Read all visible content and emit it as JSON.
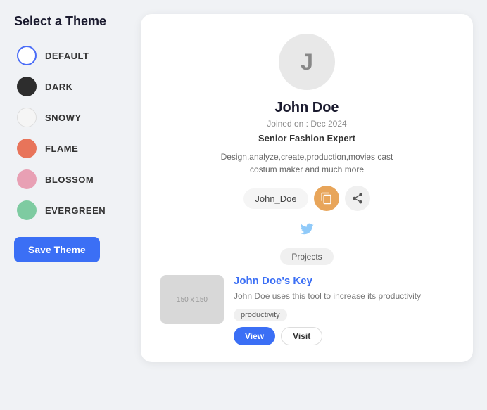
{
  "page": {
    "title": "Select a Theme"
  },
  "themes": [
    {
      "id": "default",
      "label": "DEFAULT",
      "circle_class": "circle-default"
    },
    {
      "id": "dark",
      "label": "DARK",
      "circle_class": "circle-dark"
    },
    {
      "id": "snowy",
      "label": "SNOWY",
      "circle_class": "circle-snowy"
    },
    {
      "id": "flame",
      "label": "FLAME",
      "circle_class": "circle-flame"
    },
    {
      "id": "blossom",
      "label": "BLOSSOM",
      "circle_class": "circle-blossom"
    },
    {
      "id": "evergreen",
      "label": "EVERGREEN",
      "circle_class": "circle-evergreen"
    }
  ],
  "save_button": "Save Theme",
  "profile": {
    "avatar_letter": "J",
    "name": "John Doe",
    "joined": "Joined on : Dec 2024",
    "title": "Senior Fashion Expert",
    "bio": "Design,analyze,create,production,movies cast costum maker and much more",
    "username": "John_Doe",
    "projects_label": "Projects",
    "project": {
      "thumb_label": "150 x 150",
      "title": "John Doe's Key",
      "description": "John Doe uses this tool to increase its productivity",
      "tag": "productivity",
      "view_btn": "View",
      "visit_btn": "Visit"
    }
  },
  "icons": {
    "copy": "copy-icon",
    "share": "share-icon",
    "twitter": "twitter-icon"
  }
}
